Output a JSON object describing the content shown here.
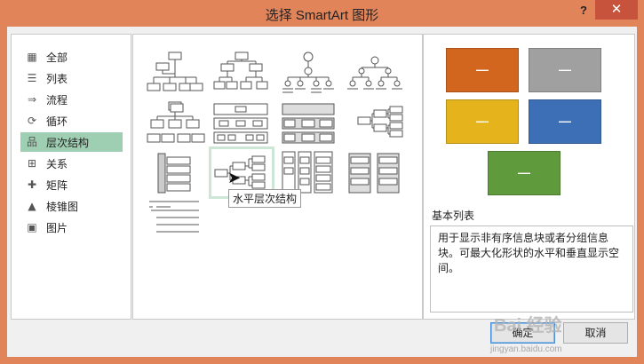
{
  "window": {
    "title": "选择 SmartArt 图形",
    "help_label": "?",
    "close_label": "✕"
  },
  "sidebar": {
    "items": [
      {
        "label": "全部",
        "icon": "all-icon",
        "selected": false
      },
      {
        "label": "列表",
        "icon": "list-icon",
        "selected": false
      },
      {
        "label": "流程",
        "icon": "process-icon",
        "selected": false
      },
      {
        "label": "循环",
        "icon": "cycle-icon",
        "selected": false
      },
      {
        "label": "层次结构",
        "icon": "hierarchy-icon",
        "selected": true
      },
      {
        "label": "关系",
        "icon": "relationship-icon",
        "selected": false
      },
      {
        "label": "矩阵",
        "icon": "matrix-icon",
        "selected": false
      },
      {
        "label": "棱锥图",
        "icon": "pyramid-icon",
        "selected": false
      },
      {
        "label": "图片",
        "icon": "picture-icon",
        "selected": false
      }
    ]
  },
  "gallery": {
    "tooltip": "水平层次结构",
    "hovered_index": 9
  },
  "preview": {
    "swatch_label": "—",
    "colors": [
      "#d2661f",
      "#a0a0a0",
      "#e5b31b",
      "#3d6fb6",
      "#5f9a3c"
    ],
    "title": "基本列表",
    "description": "用于显示非有序信息块或者分组信息块。可最大化形状的水平和垂直显示空间。"
  },
  "buttons": {
    "ok": "确定",
    "cancel": "取消"
  },
  "watermark": {
    "main": "Bai 经验",
    "sub": "jingyan.baidu.com"
  }
}
